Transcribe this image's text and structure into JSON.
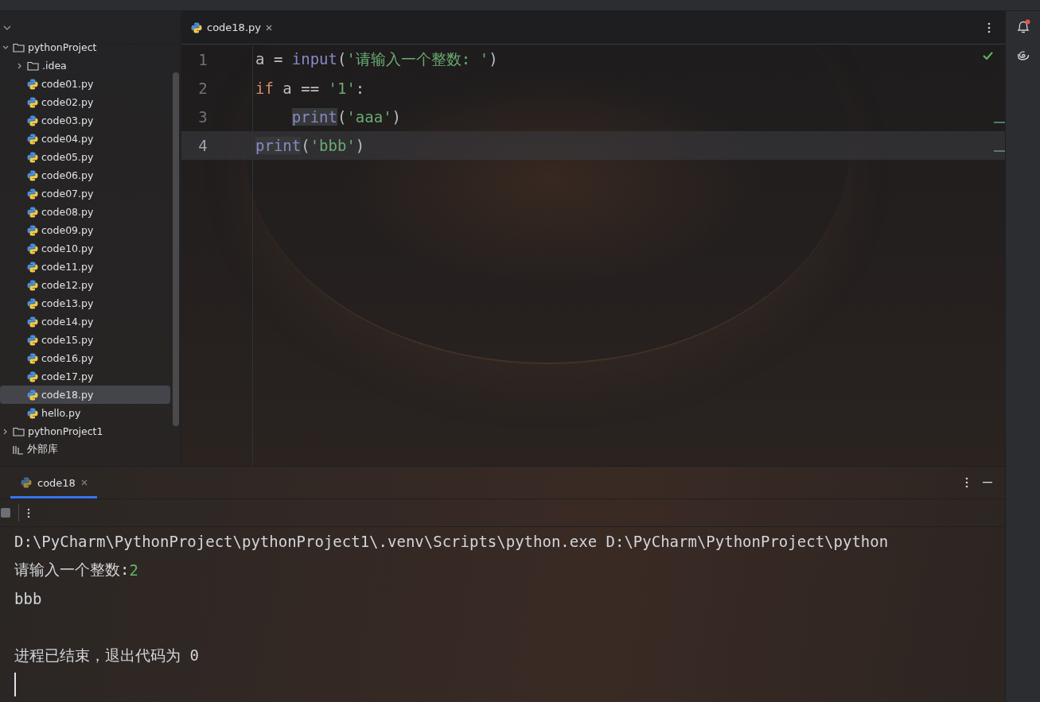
{
  "project_tree": {
    "items": [
      {
        "label": "pythonProject",
        "kind": "folder",
        "expanded": true,
        "selected": false,
        "children": [
          {
            "label": ".idea",
            "kind": "folder",
            "expanded": false,
            "selected": false
          },
          {
            "label": "code01.py",
            "kind": "file",
            "selected": false
          },
          {
            "label": "code02.py",
            "kind": "file",
            "selected": false
          },
          {
            "label": "code03.py",
            "kind": "file",
            "selected": false
          },
          {
            "label": "code04.py",
            "kind": "file",
            "selected": false
          },
          {
            "label": "code05.py",
            "kind": "file",
            "selected": false
          },
          {
            "label": "code06.py",
            "kind": "file",
            "selected": false
          },
          {
            "label": "code07.py",
            "kind": "file",
            "selected": false
          },
          {
            "label": "code08.py",
            "kind": "file",
            "selected": false
          },
          {
            "label": "code09.py",
            "kind": "file",
            "selected": false
          },
          {
            "label": "code10.py",
            "kind": "file",
            "selected": false
          },
          {
            "label": "code11.py",
            "kind": "file",
            "selected": false
          },
          {
            "label": "code12.py",
            "kind": "file",
            "selected": false
          },
          {
            "label": "code13.py",
            "kind": "file",
            "selected": false
          },
          {
            "label": "code14.py",
            "kind": "file",
            "selected": false
          },
          {
            "label": "code15.py",
            "kind": "file",
            "selected": false
          },
          {
            "label": "code16.py",
            "kind": "file",
            "selected": false
          },
          {
            "label": "code17.py",
            "kind": "file",
            "selected": false
          },
          {
            "label": "code18.py",
            "kind": "file",
            "selected": true
          },
          {
            "label": "hello.py",
            "kind": "file",
            "selected": false
          }
        ]
      },
      {
        "label": "pythonProject1",
        "kind": "folder",
        "expanded": false,
        "selected": false
      },
      {
        "label": "外部库",
        "kind": "library",
        "selected": false
      }
    ]
  },
  "editor": {
    "tabs": [
      {
        "label": "code18.py",
        "selected": true
      }
    ],
    "lines": [
      {
        "number": "1",
        "current": false,
        "tokens": [
          {
            "text": "a = ",
            "kind": "plain"
          },
          {
            "text": "input",
            "kind": "builtin"
          },
          {
            "text": "(",
            "kind": "plain"
          },
          {
            "text": "'请输入一个整数: '",
            "kind": "string"
          },
          {
            "text": ")",
            "kind": "plain"
          }
        ]
      },
      {
        "number": "2",
        "current": false,
        "tokens": [
          {
            "text": "if",
            "kind": "keyword"
          },
          {
            "text": " a == ",
            "kind": "plain"
          },
          {
            "text": "'1'",
            "kind": "string"
          },
          {
            "text": ":",
            "kind": "plain"
          }
        ]
      },
      {
        "number": "3",
        "current": false,
        "indented": true,
        "tokens": [
          {
            "text": "print",
            "kind": "builtin",
            "highlighted": true
          },
          {
            "text": "(",
            "kind": "plain"
          },
          {
            "text": "'aaa'",
            "kind": "string"
          },
          {
            "text": ")",
            "kind": "plain"
          }
        ]
      },
      {
        "number": "4",
        "current": true,
        "tokens": [
          {
            "text": "print",
            "kind": "builtin",
            "highlighted": true
          },
          {
            "text": "(",
            "kind": "plain"
          },
          {
            "text": "'bbb'",
            "kind": "string"
          },
          {
            "text": ")",
            "kind": "plain"
          }
        ]
      }
    ]
  },
  "run_panel": {
    "tabs": [
      {
        "label": "code18",
        "selected": true
      }
    ],
    "console": [
      {
        "kind": "command",
        "text": "D:\\PyCharm\\PythonProject\\pythonProject1\\.venv\\Scripts\\python.exe D:\\PyCharm\\PythonProject\\python"
      },
      {
        "kind": "prompt",
        "text": "请输入一个整数: ",
        "input": "2"
      },
      {
        "kind": "output",
        "text": "bbb"
      },
      {
        "kind": "blank"
      },
      {
        "kind": "output",
        "text": "进程已结束，退出代码为 0"
      },
      {
        "kind": "cursor"
      }
    ]
  }
}
